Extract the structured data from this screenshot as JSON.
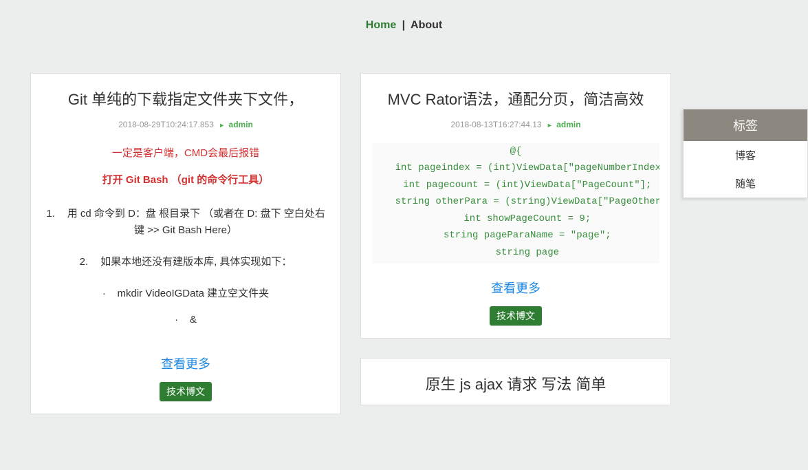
{
  "nav": {
    "home": "Home",
    "separator": "|",
    "about": "About"
  },
  "sidebar": {
    "title": "标签",
    "tags": [
      "博客",
      "随笔"
    ]
  },
  "posts": [
    {
      "title": "Git 单纯的下载指定文件夹下文件，",
      "timestamp": "2018-08-29T10:24:17.853",
      "author": "admin",
      "warn1": "一定是客户端，CMD会最后报错",
      "warn2": "打开 Git Bash  （git 的命令行工具）",
      "step1_num": "1.",
      "step1": "用 cd 命令到 D：盘 根目录下 （或者在 D: 盘下 空白处右键 >> Git Bash Here）",
      "step2_num": "2.",
      "step2": "如果本地还没有建版本库, 具体实现如下：",
      "sub1_bullet": "·",
      "sub1": "mkdir VideoIGData  建立空文件夹",
      "sub2_bullet": "·",
      "sub2": "&",
      "more": "查看更多",
      "tag": "技术博文"
    },
    {
      "title": "MVC Rator语法，通配分页，简洁高效",
      "timestamp": "2018-08-13T16:27:44.13",
      "author": "admin",
      "code": "@{\n    int pageindex = (int)ViewData[\"pageNumberIndex\"];\n    int pagecount = (int)ViewData[\"PageCount\"];\n    string otherPara = (string)ViewData[\"PageOtherPara\"];\n    int showPageCount = 9;\n    string pageParaName = \"page\";\n    string page",
      "more": "查看更多",
      "tag": "技术博文"
    },
    {
      "title": "原生 js ajax 请求 写法 简单"
    }
  ]
}
